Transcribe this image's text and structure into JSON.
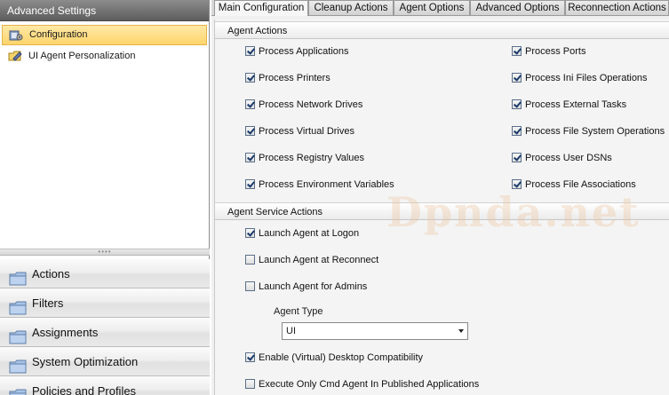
{
  "left_panel": {
    "header": "Advanced Settings",
    "tree": [
      {
        "label": "Configuration",
        "icon": "configuration-icon",
        "selected": true
      },
      {
        "label": "UI Agent Personalization",
        "icon": "personalization-icon",
        "selected": false
      }
    ],
    "nav_buttons": [
      {
        "label": "Actions",
        "icon": "folder-icon"
      },
      {
        "label": "Filters",
        "icon": "folder-icon"
      },
      {
        "label": "Assignments",
        "icon": "folder-icon"
      },
      {
        "label": "System Optimization",
        "icon": "folder-icon"
      },
      {
        "label": "Policies and Profiles",
        "icon": "folder-icon"
      }
    ]
  },
  "tabs": [
    {
      "label": "Main Configuration",
      "active": true
    },
    {
      "label": "Cleanup Actions",
      "active": false
    },
    {
      "label": "Agent Options",
      "active": false
    },
    {
      "label": "Advanced Options",
      "active": false
    },
    {
      "label": "Reconnection Actions",
      "active": false
    }
  ],
  "agent_actions": {
    "title": "Agent Actions",
    "left": [
      {
        "label": "Process Applications",
        "checked": true
      },
      {
        "label": "Process Printers",
        "checked": true
      },
      {
        "label": "Process Network Drives",
        "checked": true
      },
      {
        "label": "Process Virtual Drives",
        "checked": true
      },
      {
        "label": "Process Registry Values",
        "checked": true
      },
      {
        "label": "Process Environment Variables",
        "checked": true
      }
    ],
    "right": [
      {
        "label": "Process Ports",
        "checked": true
      },
      {
        "label": "Process Ini Files Operations",
        "checked": true
      },
      {
        "label": "Process External Tasks",
        "checked": true
      },
      {
        "label": "Process File System Operations",
        "checked": true
      },
      {
        "label": "Process User DSNs",
        "checked": true
      },
      {
        "label": "Process File Associations",
        "checked": true
      }
    ]
  },
  "agent_service_actions": {
    "title": "Agent Service Actions",
    "items": [
      {
        "label": "Launch Agent at Logon",
        "checked": true
      },
      {
        "label": "Launch Agent at Reconnect",
        "checked": false
      },
      {
        "label": "Launch Agent for Admins",
        "checked": false
      }
    ],
    "agent_type_label": "Agent Type",
    "agent_type_value": "UI",
    "more_items": [
      {
        "label": "Enable (Virtual) Desktop Compatibility",
        "checked": true
      },
      {
        "label": "Execute Only Cmd Agent In Published Applications",
        "checked": false
      }
    ]
  },
  "watermark": "Dpnda.net"
}
